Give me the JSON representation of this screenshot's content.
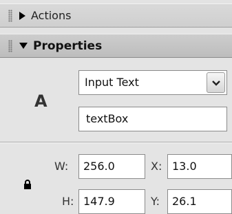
{
  "actions_panel": {
    "title": "Actions",
    "icon": "triangle-right-icon"
  },
  "properties_panel": {
    "title": "Properties",
    "icon": "triangle-down-icon",
    "tool_icon_glyph": "A",
    "text_type": {
      "value": "Input Text",
      "options": [
        "Input Text"
      ]
    },
    "instance_name": "textBox",
    "dimensions": {
      "w_label": "W:",
      "w_value": "256.0",
      "h_label": "H:",
      "h_value": "147.9",
      "x_label": "X:",
      "x_value": "13.0",
      "y_label": "Y:",
      "y_value": "26.1"
    },
    "lock_icon": "lock-icon"
  }
}
